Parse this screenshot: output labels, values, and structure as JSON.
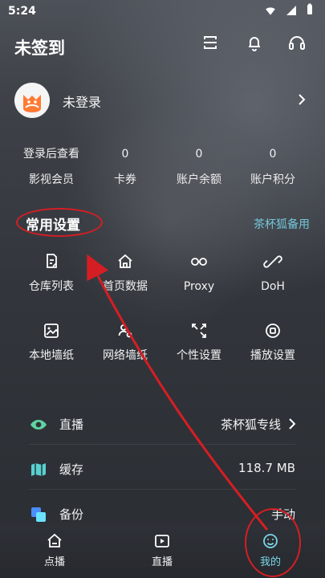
{
  "status": {
    "time": "5:24"
  },
  "header": {
    "title": "未签到"
  },
  "profile": {
    "name": "未登录"
  },
  "stats": [
    {
      "value": "登录后查看",
      "label": "影视会员"
    },
    {
      "value": "0",
      "label": "卡券"
    },
    {
      "value": "0",
      "label": "账户余额"
    },
    {
      "value": "0",
      "label": "账户积分"
    }
  ],
  "common_settings": {
    "title": "常用设置",
    "link": "茶杯狐备用",
    "items": [
      {
        "label": "仓库列表",
        "icon": "document-edit-icon"
      },
      {
        "label": "首页数据",
        "icon": "home-icon"
      },
      {
        "label": "Proxy",
        "icon": "link-icon"
      },
      {
        "label": "DoH",
        "icon": "chain-icon"
      },
      {
        "label": "本地墙纸",
        "icon": "image-icon"
      },
      {
        "label": "网络墙纸",
        "icon": "person-search-icon"
      },
      {
        "label": "个性设置",
        "icon": "expand-icon"
      },
      {
        "label": "播放设置",
        "icon": "play-settings-icon"
      }
    ]
  },
  "list": [
    {
      "label": "直播",
      "value": "茶杯狐专线",
      "icon": "eye-icon"
    },
    {
      "label": "缓存",
      "value": "118.7 MB",
      "icon": "map-icon"
    },
    {
      "label": "备份",
      "value": "手动",
      "icon": "backup-icon"
    }
  ],
  "bottom_nav": [
    {
      "label": "点播",
      "icon": "home-outline-icon",
      "active": false
    },
    {
      "label": "直播",
      "icon": "play-box-icon",
      "active": false
    },
    {
      "label": "我的",
      "icon": "smile-icon",
      "active": true
    }
  ],
  "colors": {
    "accent": "#73c7da",
    "annotation": "#d51e23",
    "live_icon": "#5fd4a1",
    "cache_icon": "#58d1d0",
    "backup_icon_primary": "#4a8dff",
    "backup_icon_secondary": "#6be2ff"
  }
}
